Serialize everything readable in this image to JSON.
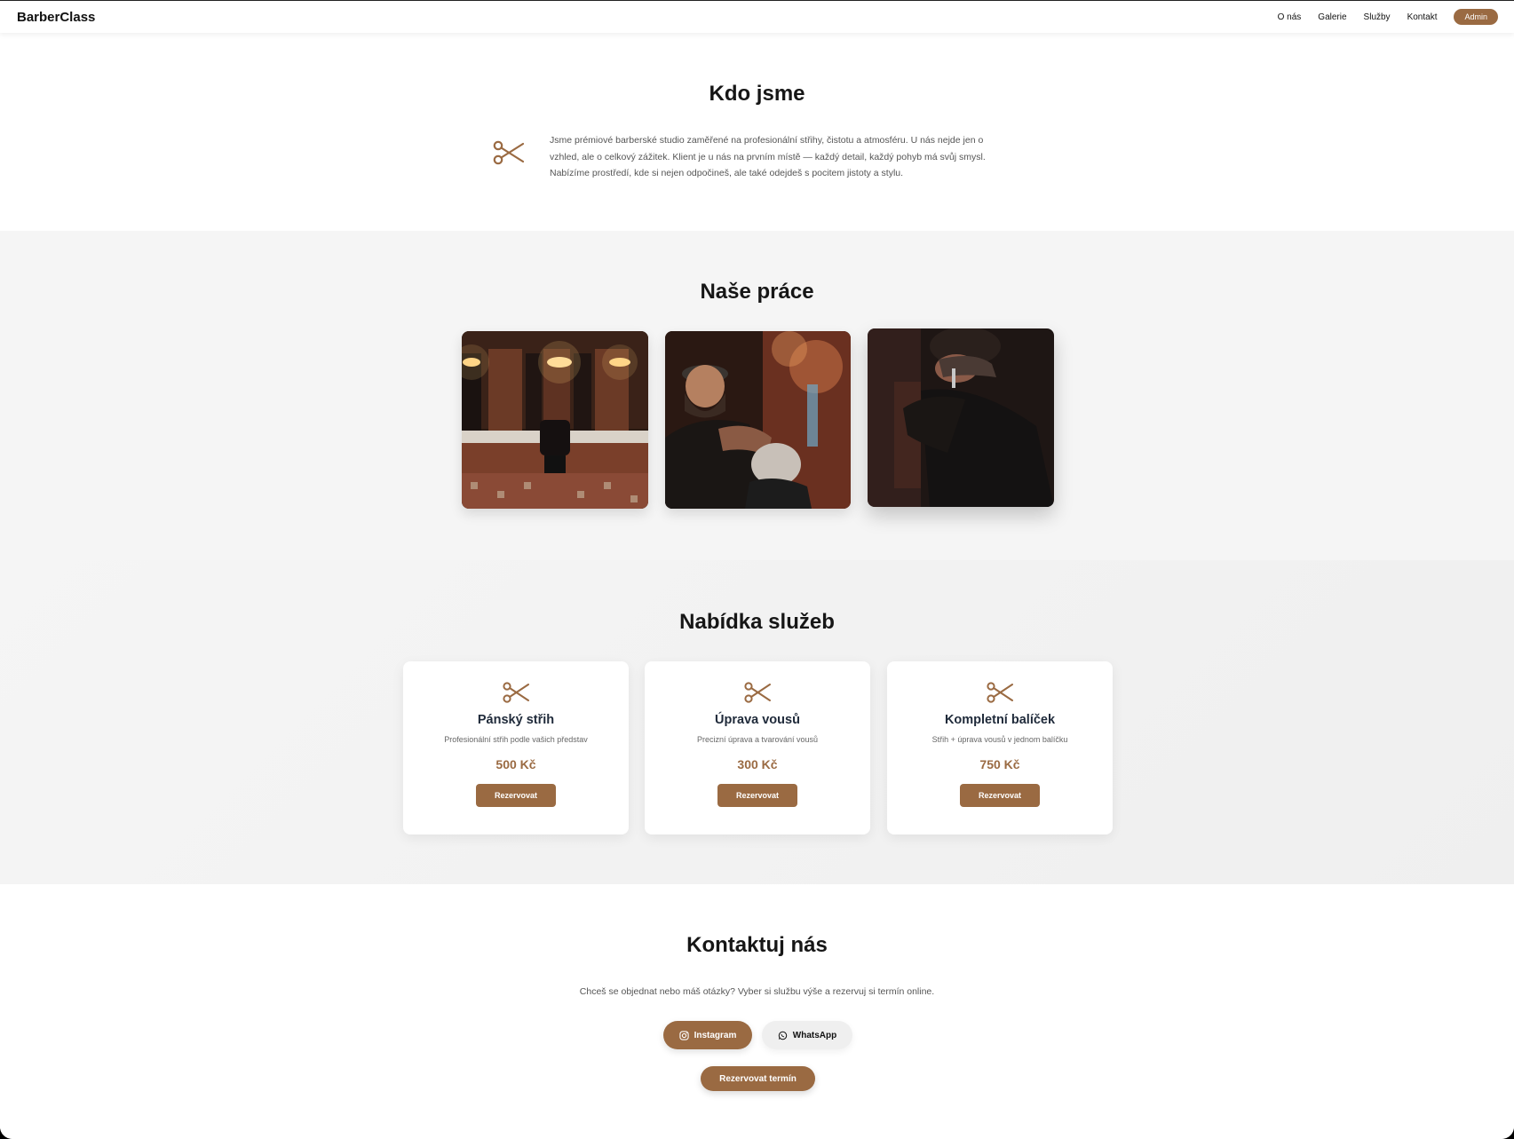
{
  "header": {
    "brand": "BarberClass",
    "nav": [
      "O nás",
      "Galerie",
      "Služby",
      "Kontakt"
    ],
    "admin_label": "Admin"
  },
  "about": {
    "title": "Kdo jsme",
    "icon": "scissors-icon",
    "lines": [
      "Jsme prémiové barberské studio zaměřené na profesionální střihy, čistotu a atmosféru. U nás nejde jen o",
      "vzhled, ale o celkový zážitek. Klient je u nás na prvním místě — každý detail, každý pohyb má svůj smysl.",
      "Nabízíme prostředí, kde si nejen odpočineš, ale také odejdeš s pocitem jistoty a stylu."
    ]
  },
  "gallery": {
    "title": "Naše práce"
  },
  "services": {
    "title": "Nabídka služeb",
    "items": [
      {
        "name": "Pánský střih",
        "desc": "Profesionální střih podle vašich představ",
        "price": "500 Kč",
        "button": "Rezervovat"
      },
      {
        "name": "Úprava vousů",
        "desc": "Precizní úprava a tvarování vousů",
        "price": "300 Kč",
        "button": "Rezervovat"
      },
      {
        "name": "Kompletní balíček",
        "desc": "Střih + úprava vousů v jednom balíčku",
        "price": "750 Kč",
        "button": "Rezervovat"
      }
    ]
  },
  "contact": {
    "title": "Kontaktuj nás",
    "text": "Chceš se objednat nebo máš otázky? Vyber si službu výše a rezervuj si termín online.",
    "instagram": "Instagram",
    "whatsapp": "WhatsApp",
    "book": "Rezervovat termín"
  },
  "colors": {
    "accent": "#9a6a42",
    "background_alt": "#f5f5f5"
  }
}
